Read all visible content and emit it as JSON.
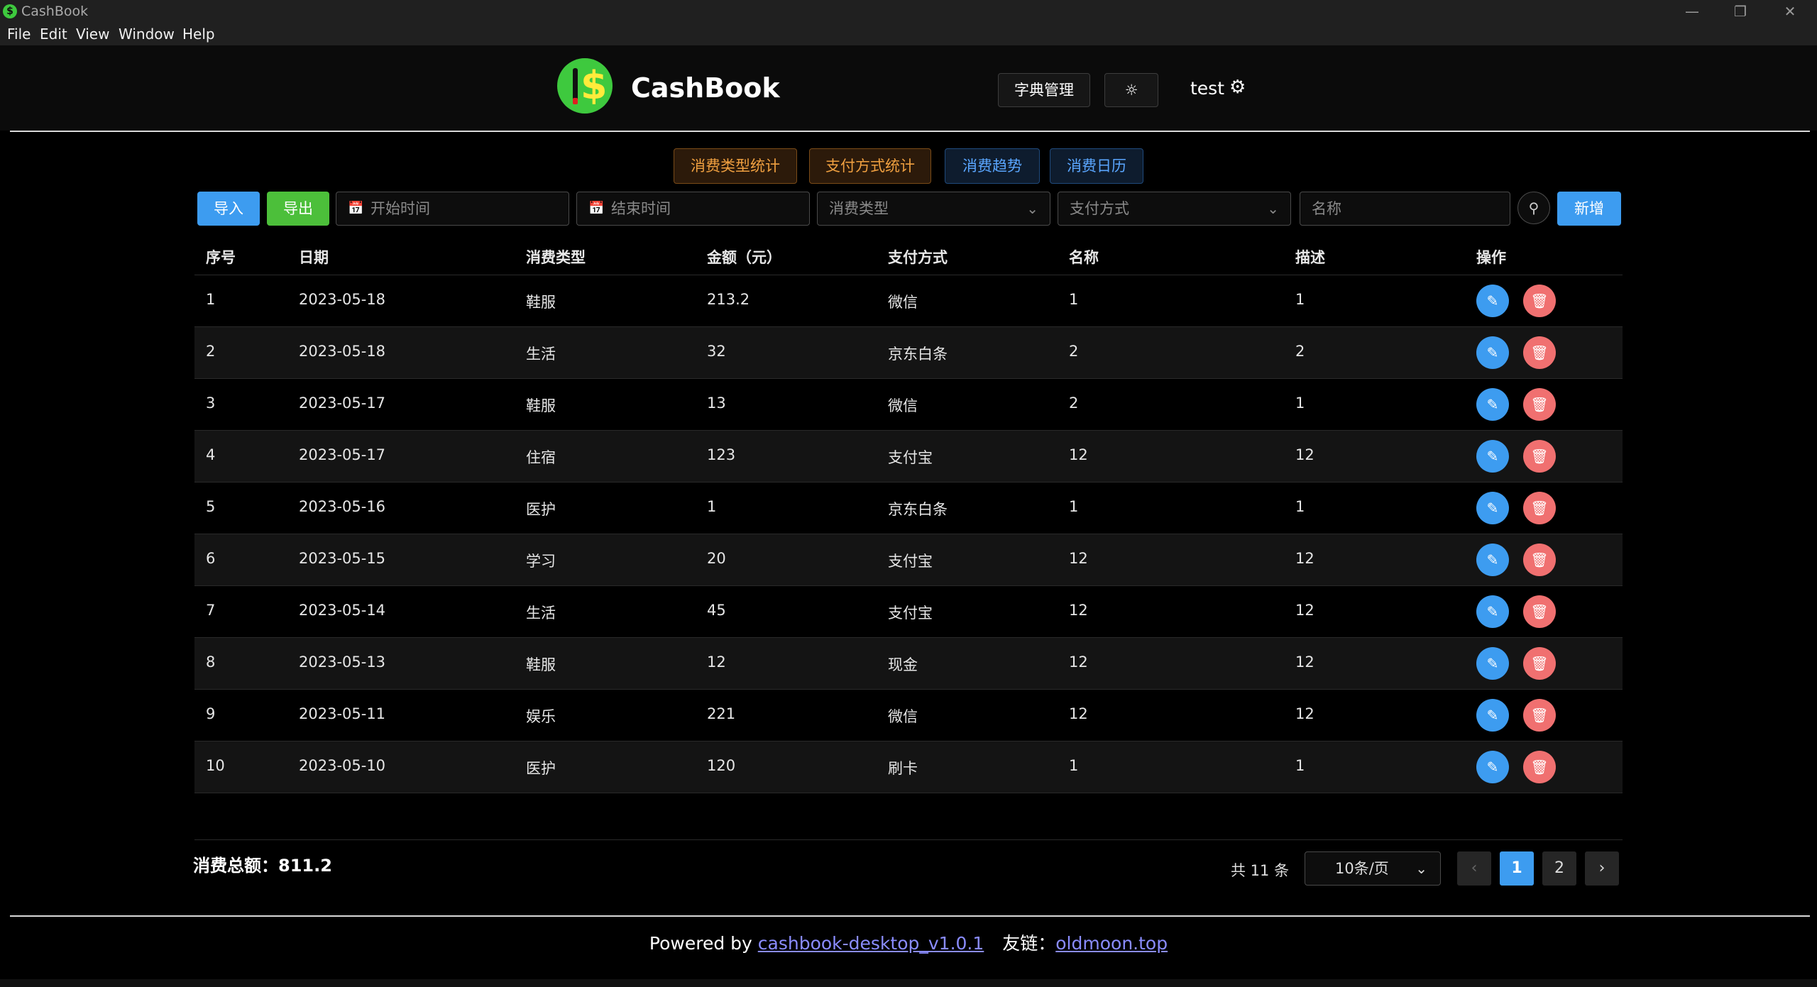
{
  "window": {
    "title": "CashBook"
  },
  "menu": [
    "File",
    "Edit",
    "View",
    "Window",
    "Help"
  ],
  "header": {
    "brand": "CashBook",
    "dict_button": "字典管理",
    "theme_icon": "theme-toggle-icon",
    "user": "test"
  },
  "stats_tabs": [
    {
      "label": "消费类型统计",
      "style": "orange"
    },
    {
      "label": "支付方式统计",
      "style": "orange"
    },
    {
      "label": "消费趋势",
      "style": "blue"
    },
    {
      "label": "消费日历",
      "style": "blue"
    }
  ],
  "toolbar": {
    "import_label": "导入",
    "export_label": "导出",
    "start_placeholder": "开始时间",
    "end_placeholder": "结束时间",
    "type_placeholder": "消费类型",
    "pay_placeholder": "支付方式",
    "name_placeholder": "名称",
    "add_label": "新增"
  },
  "table": {
    "headers": [
      "序号",
      "日期",
      "消费类型",
      "金额（元）",
      "支付方式",
      "名称",
      "描述",
      "操作"
    ],
    "rows": [
      [
        "1",
        "2023-05-18",
        "鞋服",
        "213.2",
        "微信",
        "1",
        "1"
      ],
      [
        "2",
        "2023-05-18",
        "生活",
        "32",
        "京东白条",
        "2",
        "2"
      ],
      [
        "3",
        "2023-05-17",
        "鞋服",
        "13",
        "微信",
        "2",
        "1"
      ],
      [
        "4",
        "2023-05-17",
        "住宿",
        "123",
        "支付宝",
        "12",
        "12"
      ],
      [
        "5",
        "2023-05-16",
        "医护",
        "1",
        "京东白条",
        "1",
        "1"
      ],
      [
        "6",
        "2023-05-15",
        "学习",
        "20",
        "支付宝",
        "12",
        "12"
      ],
      [
        "7",
        "2023-05-14",
        "生活",
        "45",
        "支付宝",
        "12",
        "12"
      ],
      [
        "8",
        "2023-05-13",
        "鞋服",
        "12",
        "现金",
        "12",
        "12"
      ],
      [
        "9",
        "2023-05-11",
        "娱乐",
        "221",
        "微信",
        "12",
        "12"
      ],
      [
        "10",
        "2023-05-10",
        "医护",
        "120",
        "刷卡",
        "1",
        "1"
      ]
    ]
  },
  "summary": {
    "total_label": "消费总额：",
    "total_value": "811.2"
  },
  "pagination": {
    "total_text": "共 11 条",
    "page_size": "10条/页",
    "pages": [
      "1",
      "2"
    ],
    "current": "1"
  },
  "footer": {
    "powered_by": "Powered by ",
    "version_link": "cashbook-desktop_v1.0.1",
    "friend_label": "友链：",
    "friend_link": "oldmoon.top"
  },
  "colors": {
    "import": "#3d9cf0",
    "export": "#4cbf3a",
    "add": "#3d9cf0",
    "edit": "#3d9cf0",
    "delete": "#f07070"
  }
}
